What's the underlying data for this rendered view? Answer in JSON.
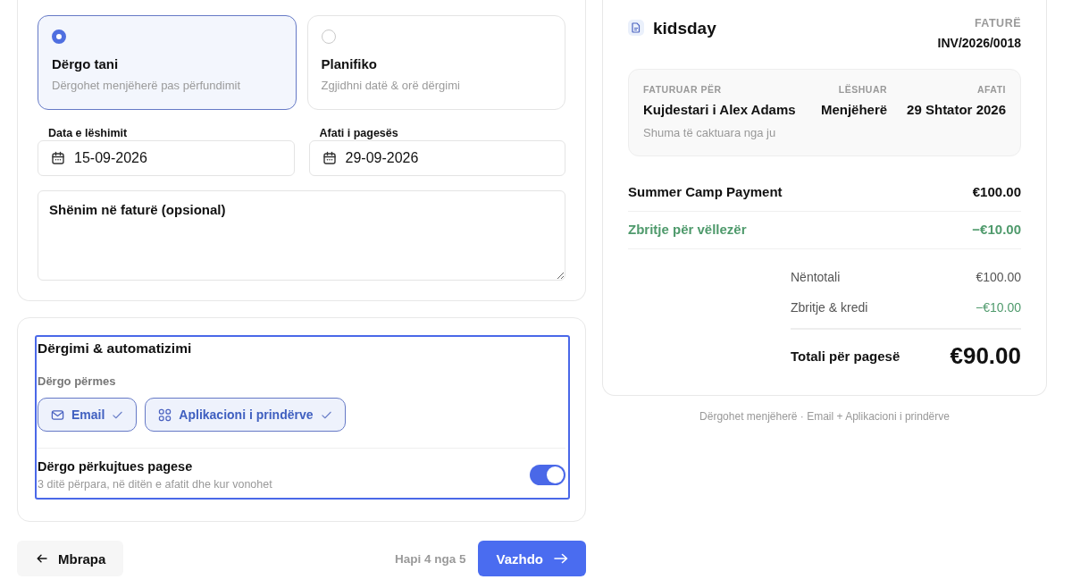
{
  "send_options": [
    {
      "title": "Dërgo tani",
      "description": "Dërgohet menjëherë pas përfundimit",
      "selected": true
    },
    {
      "title": "Planifiko",
      "description": "Zgjidhni datë & orë dërgimi",
      "selected": false
    }
  ],
  "dates": [
    {
      "label": "Data e lëshimit",
      "value": "15-09-2026"
    },
    {
      "label": "Afati i pagesës",
      "value": "29-09-2026"
    }
  ],
  "note": {
    "placeholder": "Shënim në faturë (opsional)"
  },
  "delivery": {
    "title": "Dërgimi & automatizimi",
    "channels_label": "Dërgo përmes",
    "channels": [
      {
        "label": "Email",
        "kind": "mail",
        "checked": true
      },
      {
        "label": "Aplikacioni i prindërve",
        "kind": "apps",
        "checked": true
      }
    ],
    "reminder": {
      "title": "Dërgo përkujtues pagese",
      "description": "3 ditë përpara, në ditën e afatit dhe kur vonohet",
      "on": true
    }
  },
  "navigation": {
    "back": "Mbrapa",
    "step": "Hapi 4 nga 5",
    "next": "Vazhdo"
  },
  "invoice": {
    "brand": "kidsday",
    "doc_label": "FATURË",
    "number": "INV/2026/0018",
    "meta": [
      {
        "label": "FATURUAR PËR",
        "value": "Kujdestari i Alex Adams",
        "sub": "Shuma të caktuara nga ju"
      },
      {
        "label": "LËSHUAR",
        "value": "Menjëherë"
      },
      {
        "label": "AFATI",
        "value": "29 Shtator 2026"
      }
    ],
    "items": [
      {
        "label": "Summer Camp Payment",
        "amount": "€100.00",
        "kind": "charge"
      },
      {
        "label": "Zbritje për vëllezër",
        "amount": "−€10.00",
        "kind": "discount"
      }
    ],
    "summary": [
      {
        "label": "Nëntotali",
        "amount": "€100.00",
        "kind": "charge"
      },
      {
        "label": "Zbritje & kredi",
        "amount": "−€10.00",
        "kind": "discount"
      }
    ],
    "total": {
      "label": "Totali për pagesë",
      "amount": "€90.00"
    }
  },
  "footer_note": "Dërgohet menjëherë · Email + Aplikacioni i prindërve"
}
